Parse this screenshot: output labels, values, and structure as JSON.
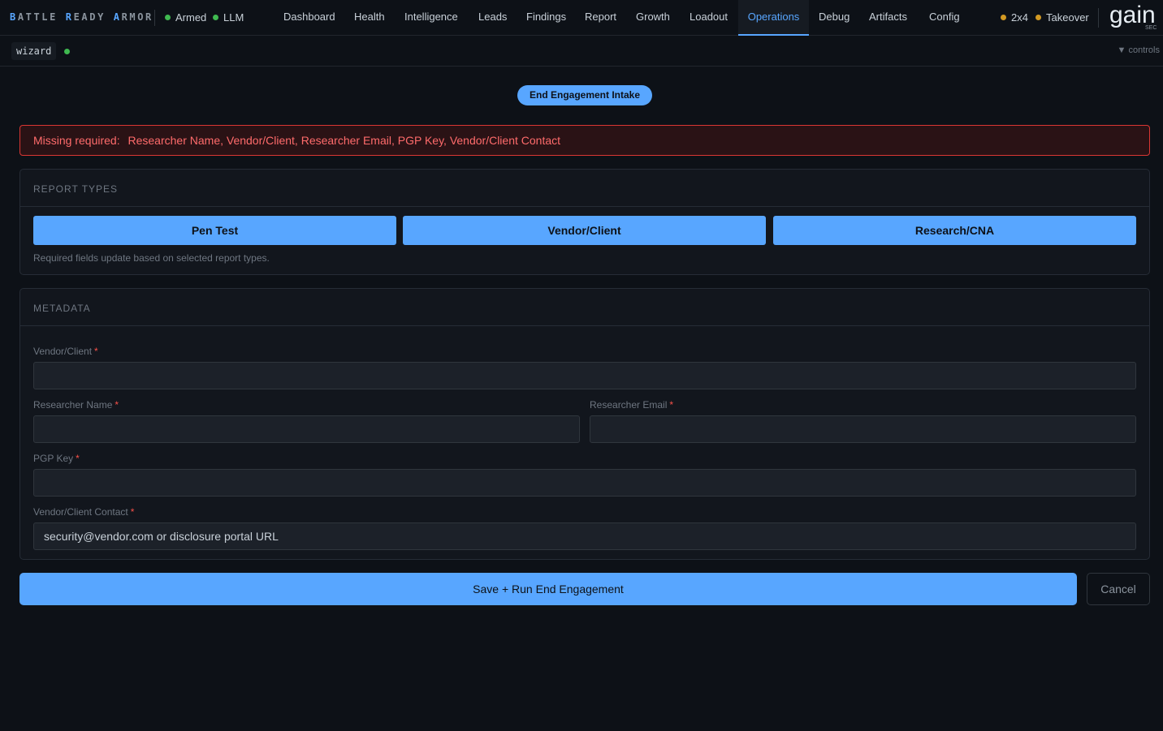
{
  "brand": {
    "words": [
      {
        "cap": "B",
        "rest": "ATTLE"
      },
      {
        "cap": "R",
        "rest": "EADY"
      },
      {
        "cap": "A",
        "rest": "RMOR"
      }
    ]
  },
  "status": {
    "armed": "Armed",
    "llm": "LLM"
  },
  "nav": {
    "tabs": [
      "Dashboard",
      "Health",
      "Intelligence",
      "Leads",
      "Findings",
      "Report",
      "Growth",
      "Loadout",
      "Operations",
      "Debug",
      "Artifacts",
      "Config"
    ],
    "active": "Operations"
  },
  "right_status": {
    "grid": "2x4",
    "takeover": "Takeover"
  },
  "logo": {
    "text": "gain",
    "sub": "SEC"
  },
  "subbar": {
    "mode": "wizard",
    "controls": "▼ controls"
  },
  "page": {
    "pill": "End Engagement Intake",
    "alert_prefix": "Missing required:",
    "alert_items": "Researcher Name, Vendor/Client, Researcher Email, PGP Key, Vendor/Client Contact"
  },
  "report_types": {
    "header": "REPORT TYPES",
    "buttons": [
      "Pen Test",
      "Vendor/Client",
      "Research/CNA"
    ],
    "hint": "Required fields update based on selected report types."
  },
  "metadata": {
    "header": "METADATA",
    "vendor_label": "Vendor/Client",
    "vendor_value": "",
    "researcher_name_label": "Researcher Name",
    "researcher_name_value": "",
    "researcher_email_label": "Researcher Email",
    "researcher_email_value": "",
    "pgp_label": "PGP Key",
    "pgp_value": "",
    "contact_label": "Vendor/Client Contact",
    "contact_placeholder": "security@vendor.com or disclosure portal URL",
    "required_mark": "*"
  },
  "actions": {
    "save": "Save + Run End Engagement",
    "cancel": "Cancel"
  },
  "colors": {
    "accent": "#58a6ff",
    "ok": "#3fb950",
    "warn": "#d29922",
    "error": "#f85149"
  }
}
